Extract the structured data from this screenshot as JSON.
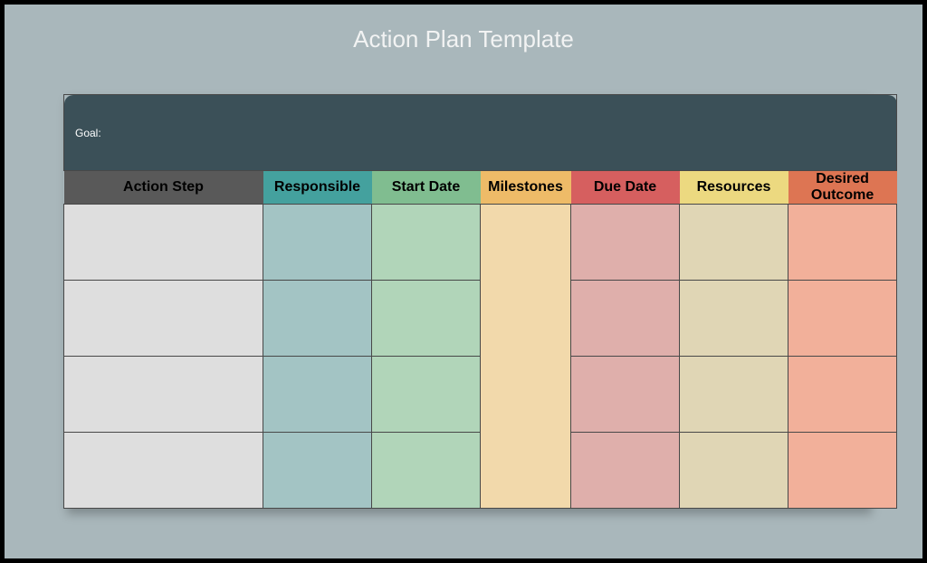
{
  "title": "Action Plan Template",
  "goal_label": "Goal:",
  "headers": {
    "action_step": "Action Step",
    "responsible": "Responsible",
    "start_date": "Start Date",
    "milestones": "Milestones",
    "due_date": "Due Date",
    "resources": "Resources",
    "desired_outcome": "Desired Outcome"
  },
  "rows": [
    {
      "action_step": "",
      "responsible": "",
      "start_date": "",
      "due_date": "",
      "resources": "",
      "desired_outcome": ""
    },
    {
      "action_step": "",
      "responsible": "",
      "start_date": "",
      "due_date": "",
      "resources": "",
      "desired_outcome": ""
    },
    {
      "action_step": "",
      "responsible": "",
      "start_date": "",
      "due_date": "",
      "resources": "",
      "desired_outcome": ""
    },
    {
      "action_step": "",
      "responsible": "",
      "start_date": "",
      "due_date": "",
      "resources": "",
      "desired_outcome": ""
    }
  ],
  "milestones_merged": ""
}
